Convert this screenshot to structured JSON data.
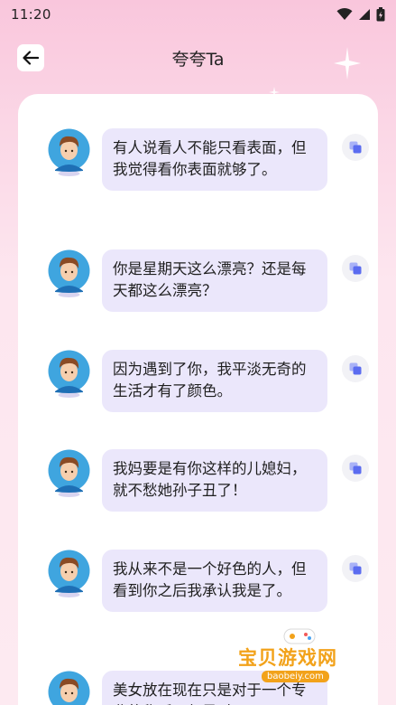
{
  "status_bar": {
    "time": "11:20"
  },
  "header": {
    "title": "夸夸Ta"
  },
  "messages": [
    {
      "text": "有人说看人不能只看表面，但我觉得看你表面就够了。"
    },
    {
      "text": "你是星期天这么漂亮？还是每天都这么漂亮？"
    },
    {
      "text": "因为遇到了你，我平淡无奇的生活才有了颜色。"
    },
    {
      "text": "我妈要是有你这样的儿媳妇，就不愁她孙子丑了！"
    },
    {
      "text": "我从来不是一个好色的人，但看到你之后我承认我是了。"
    },
    {
      "text": "美女放在现在只是对于一个专业的称呼，但是对于"
    }
  ],
  "watermark": {
    "name": "宝贝游戏网",
    "url": "baobeiy.com"
  },
  "colors": {
    "bubble": "#ebe7fb",
    "copy_icon": "#5b6cf0",
    "accent_pink": "#f9c6dc"
  }
}
